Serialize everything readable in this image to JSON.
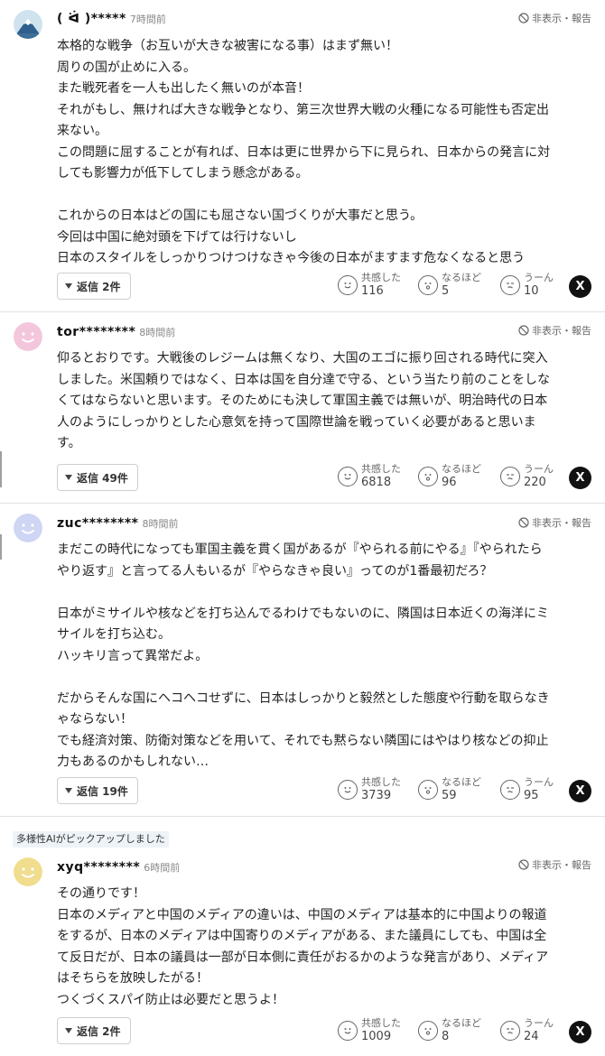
{
  "comments": [
    {
      "username": "( ᐛ )*****",
      "time": "7時間前",
      "avatar": "mountain-avatar",
      "hide_report": "非表示・報告",
      "lines": [
        "本格的な戦争（お互いが大きな被害になる事）はまず無い！",
        "周りの国が止めに入る。",
        "また戦死者を一人も出したく無いのが本音！",
        "それがもし、無ければ大きな戦争となり、第三次世界大戦の火種になる可能性も否定出",
        "来ない。",
        "この問題に屈することが有れば、日本は更に世界から下に見られ、日本からの発言に対",
        "しても影響力が低下してしまう懸念がある。",
        "",
        "これからの日本はどの国にも屈さない国づくりが大事だと思う。",
        "今回は中国に絶対頭を下げては行けないし",
        "日本のスタイルをしっかりつけつけなきゃ今後の日本がますます危なくなると思う"
      ],
      "reply_label": "返信 2件",
      "reactions": [
        {
          "label": "共感した",
          "count": "116"
        },
        {
          "label": "なるほど",
          "count": "5"
        },
        {
          "label": "うーん",
          "count": "10"
        }
      ]
    },
    {
      "username": "tor********",
      "time": "8時間前",
      "avatar": "pink-face-avatar",
      "hide_report": "非表示・報告",
      "lines": [
        "仰るとおりです。大戦後のレジームは無くなり、大国のエゴに振り回される時代に突入",
        "しました。米国頼りではなく、日本は国を自分達で守る、という当たり前のことをしな",
        "くてはならないと思います。そのためにも決して軍国主義では無いが、明治時代の日本",
        "人のようにしっかりとした心意気を持って国際世論を戦っていく必要があると思いま",
        "す。"
      ],
      "reply_label": "返信 49件",
      "reactions": [
        {
          "label": "共感した",
          "count": "6818"
        },
        {
          "label": "なるほど",
          "count": "96"
        },
        {
          "label": "うーん",
          "count": "220"
        }
      ]
    },
    {
      "username": "zuc********",
      "time": "8時間前",
      "avatar": "blue-face-avatar",
      "hide_report": "非表示・報告",
      "lines": [
        "まだこの時代になっても軍国主義を貫く国があるが『やられる前にやる』『やられたら",
        "やり返す』と言ってる人もいるが『やらなきゃ良い』ってのが1番最初だろ？",
        "",
        "日本がミサイルや核などを打ち込んでるわけでもないのに、隣国は日本近くの海洋にミ",
        "サイルを打ち込む。",
        "ハッキリ言って異常だよ。",
        "",
        "だからそんな国にヘコヘコせずに、日本はしっかりと毅然とした態度や行動を取らなき",
        "ゃならない！",
        "でも経済対策、防衛対策などを用いて、それでも黙らない隣国にはやはり核などの抑止",
        "力もあるのかもしれない…"
      ],
      "reply_label": "返信 19件",
      "reactions": [
        {
          "label": "共感した",
          "count": "3739"
        },
        {
          "label": "なるほど",
          "count": "59"
        },
        {
          "label": "うーん",
          "count": "95"
        }
      ]
    },
    {
      "username": "xyq********",
      "time": "6時間前",
      "avatar": "yellow-face-avatar",
      "hide_report": "非表示・報告",
      "lines": [
        "その通りです！",
        "日本のメディアと中国のメディアの違いは、中国のメディアは基本的に中国よりの報道",
        "をするが、日本のメディアは中国寄りのメディアがある、また議員にしても、中国は全",
        "て反日だが、日本の議員は一部が日本側に責任がおるかのような発言があり、メディア",
        "はそちらを放映したがる！",
        "つくづくスパイ防止は必要だと思うよ！"
      ],
      "reply_label": "返信 2件",
      "reactions": [
        {
          "label": "共感した",
          "count": "1009"
        },
        {
          "label": "なるほど",
          "count": "8"
        },
        {
          "label": "うーん",
          "count": "24"
        }
      ]
    }
  ],
  "pickup_label": "多様性AIがピックアップしました",
  "share_label": "X",
  "colors": {
    "divider": "#e2e2e2",
    "pickup_bg": "#eef3f8",
    "pink_avatar": "#f3c6dc",
    "blue_avatar": "#cfd6f4",
    "yellow_avatar": "#f0dd8e"
  }
}
